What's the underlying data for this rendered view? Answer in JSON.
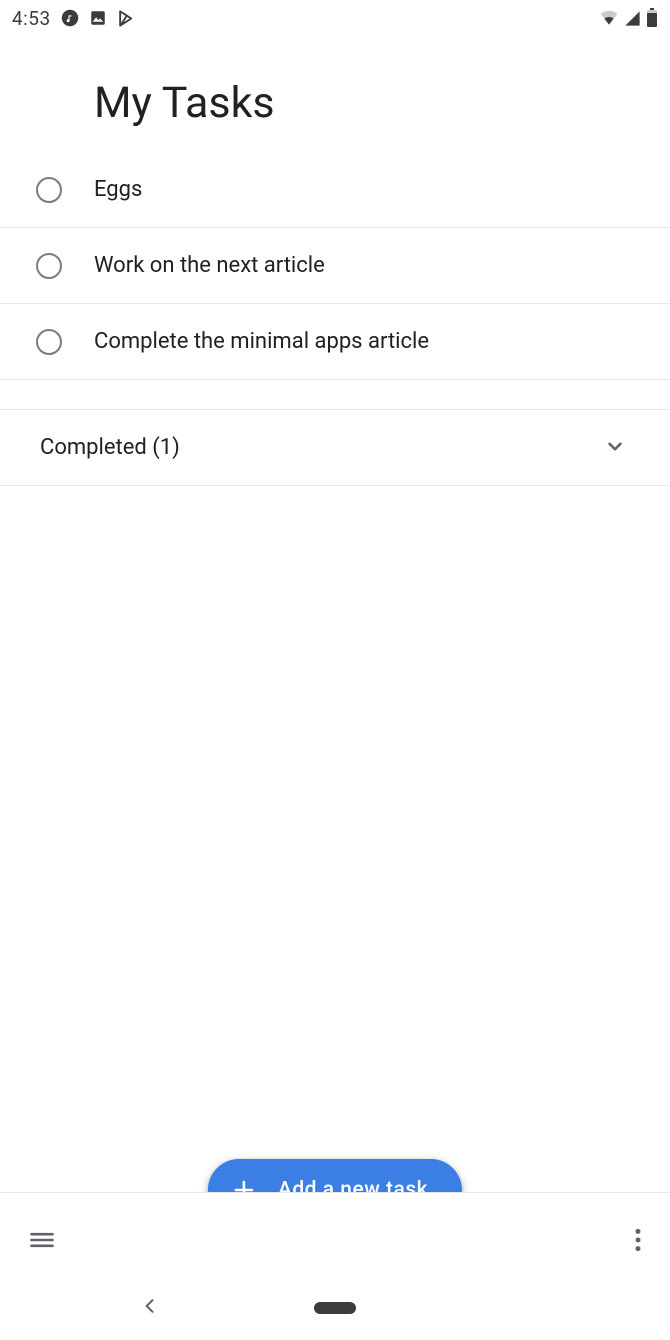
{
  "status_bar": {
    "time": "4:53",
    "left_icons": [
      "music-note-icon",
      "image-icon",
      "play-store-icon"
    ],
    "right_icons": [
      "wifi-icon",
      "cell-signal-icon",
      "battery-icon"
    ]
  },
  "header": {
    "title": "My Tasks"
  },
  "tasks": [
    {
      "title": "Eggs",
      "completed": false
    },
    {
      "title": "Work on the next article",
      "completed": false
    },
    {
      "title": "Complete the minimal apps article",
      "completed": false
    }
  ],
  "completed_section": {
    "label": "Completed (1)",
    "count": 1,
    "expanded": false
  },
  "fab": {
    "label": "Add a new task"
  },
  "colors": {
    "accent": "#3b7ee4",
    "text": "#202124",
    "hairline": "#e7e7e7",
    "muted": "#5f6368"
  }
}
